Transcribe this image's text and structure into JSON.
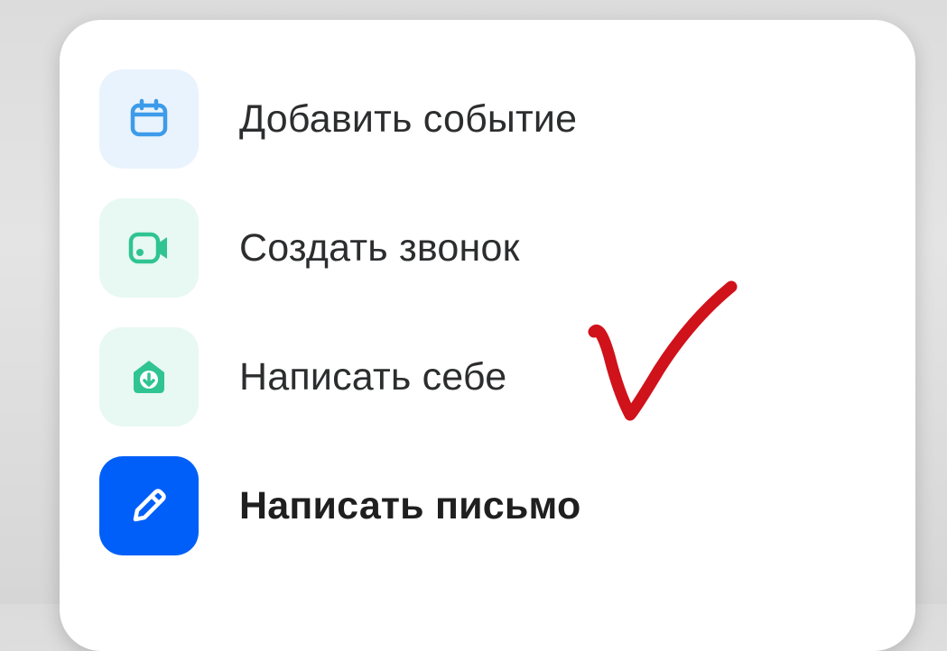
{
  "menu": {
    "items": [
      {
        "label": "Добавить событие",
        "icon": "calendar-icon"
      },
      {
        "label": "Создать звонок",
        "icon": "video-camera-icon"
      },
      {
        "label": "Написать себе",
        "icon": "inbox-download-icon"
      },
      {
        "label": "Написать письмо",
        "icon": "pencil-icon"
      }
    ]
  },
  "colors": {
    "card_background": "#ffffff",
    "calendar_accent": "#3d9be9",
    "green_accent": "#2fc492",
    "primary_blue": "#005ff9",
    "annotation_red": "#d0121b"
  }
}
